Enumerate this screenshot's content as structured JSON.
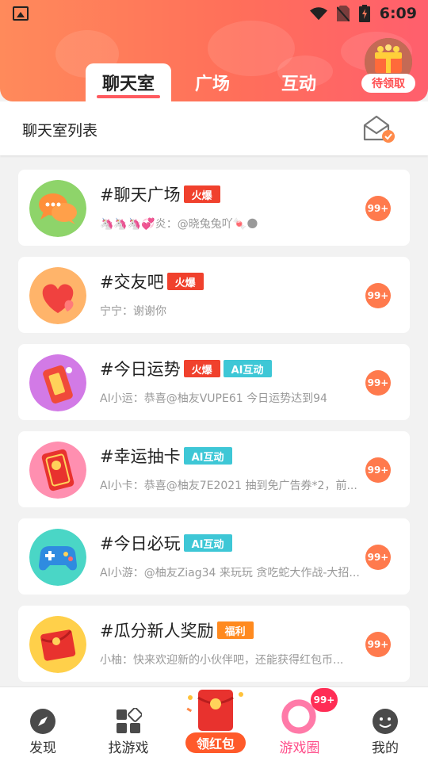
{
  "status_bar": {
    "time": "6:09"
  },
  "header": {
    "tabs": [
      {
        "label": "聊天室",
        "active": true
      },
      {
        "label": "广场",
        "active": false
      },
      {
        "label": "互动",
        "active": false
      }
    ],
    "reward_badge": "待领取"
  },
  "subheader": {
    "title": "聊天室列表"
  },
  "rooms": [
    {
      "title": "#聊天广场",
      "tags": [
        {
          "label": "火爆",
          "type": "hot"
        }
      ],
      "subtitle": "🦄🦄🦄💞炎：@晓兔兔吖🍬🌑",
      "count": "99+",
      "avatar_icon": "chat-bubbles-icon",
      "avatar_color": "#6cc45a"
    },
    {
      "title": "#交友吧",
      "tags": [
        {
          "label": "火爆",
          "type": "hot"
        }
      ],
      "subtitle": "宁宁：谢谢你",
      "count": "99+",
      "avatar_icon": "heart-icon",
      "avatar_color": "#ff9a5a"
    },
    {
      "title": "#今日运势",
      "tags": [
        {
          "label": "火爆",
          "type": "hot"
        },
        {
          "label": "AI互动",
          "type": "ai"
        }
      ],
      "subtitle": "AI小运：恭喜@柚友VUPE61 今日运势达到94",
      "count": "99+",
      "avatar_icon": "fortune-tag-icon",
      "avatar_color": "#c45ad6"
    },
    {
      "title": "#幸运抽卡",
      "tags": [
        {
          "label": "AI互动",
          "type": "ai"
        }
      ],
      "subtitle": "AI小卡：恭喜@柚友7E2021 抽到免广告券*2，前...",
      "count": "99+",
      "avatar_icon": "lucky-card-icon",
      "avatar_color": "#ff7a9a"
    },
    {
      "title": "#今日必玩",
      "tags": [
        {
          "label": "AI互动",
          "type": "ai"
        }
      ],
      "subtitle": "AI小游：@柚友Ziag34 来玩玩 贪吃蛇大作战-大招...",
      "count": "99+",
      "avatar_icon": "gamepad-icon",
      "avatar_color": "#32c8b8"
    },
    {
      "title": "#瓜分新人奖励",
      "tags": [
        {
          "label": "福利",
          "type": "gift"
        }
      ],
      "subtitle": "小柚：快来欢迎新的小伙伴吧，还能获得红包币...",
      "count": "99+",
      "avatar_icon": "red-envelope-icon",
      "avatar_color": "#ffc23a"
    }
  ],
  "bottom_nav": {
    "items": [
      {
        "label": "发现",
        "icon": "compass-icon"
      },
      {
        "label": "找游戏",
        "icon": "grid-icon"
      },
      {
        "label": "领红包",
        "icon": "red-envelope-icon"
      },
      {
        "label": "游戏圈",
        "icon": "ring-icon"
      },
      {
        "label": "我的",
        "icon": "smile-icon"
      }
    ],
    "badge": "99+"
  }
}
